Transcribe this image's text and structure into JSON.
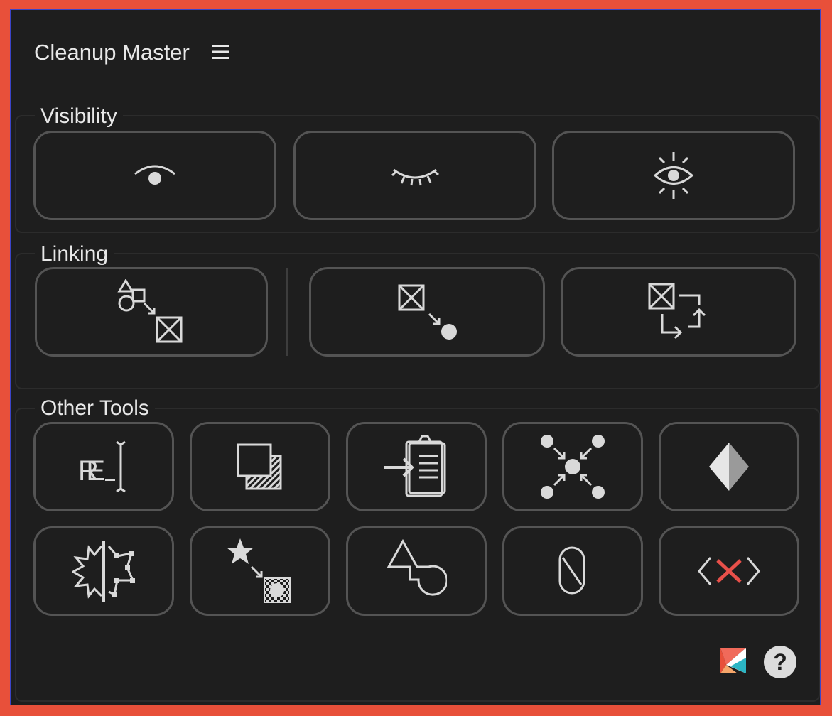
{
  "app": {
    "title": "Cleanup Master",
    "menu_icon": "hamburger-menu-icon"
  },
  "sections": {
    "visibility": {
      "label": "Visibility"
    },
    "linking": {
      "label": "Linking"
    },
    "other_tools": {
      "label": "Other Tools"
    }
  },
  "footer": {
    "help_label": "?"
  },
  "colors": {
    "frame": "#e8503a",
    "panel": "#1e1e1e",
    "button_border": "#545454",
    "icon": "#d9d9d9",
    "accent_red": "#e8504a"
  }
}
